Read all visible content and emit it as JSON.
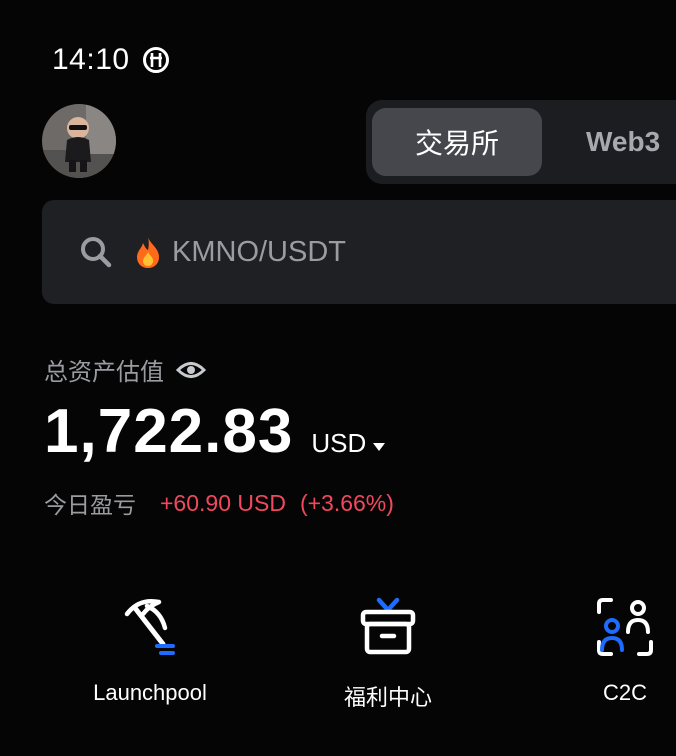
{
  "status_bar": {
    "time": "14:10",
    "icon": "data-saver-icon"
  },
  "header": {
    "avatar": "user-avatar",
    "tabs": [
      {
        "label": "交易所",
        "active": true
      },
      {
        "label": "Web3",
        "active": false
      }
    ]
  },
  "search": {
    "icon": "search-icon",
    "hot_icon": "fire-icon",
    "placeholder": "KMNO/USDT"
  },
  "assets": {
    "label": "总资产估值",
    "visibility_icon": "eye-icon",
    "value": "1,722.83",
    "currency": "USD",
    "today_pnl_label": "今日盈亏",
    "today_pnl_amount": "+60.90 USD",
    "today_pnl_percent": "(+3.66%)"
  },
  "shortcuts": [
    {
      "label": "Launchpool",
      "icon": "pickaxe-icon"
    },
    {
      "label": "福利中心",
      "icon": "gift-icon"
    },
    {
      "label": "C2C",
      "icon": "users-scan-icon"
    }
  ],
  "colors": {
    "background": "#050505",
    "accent_blue": "#1e6bff",
    "loss_red": "#f0495e",
    "muted_text": "#9a9ca1"
  }
}
